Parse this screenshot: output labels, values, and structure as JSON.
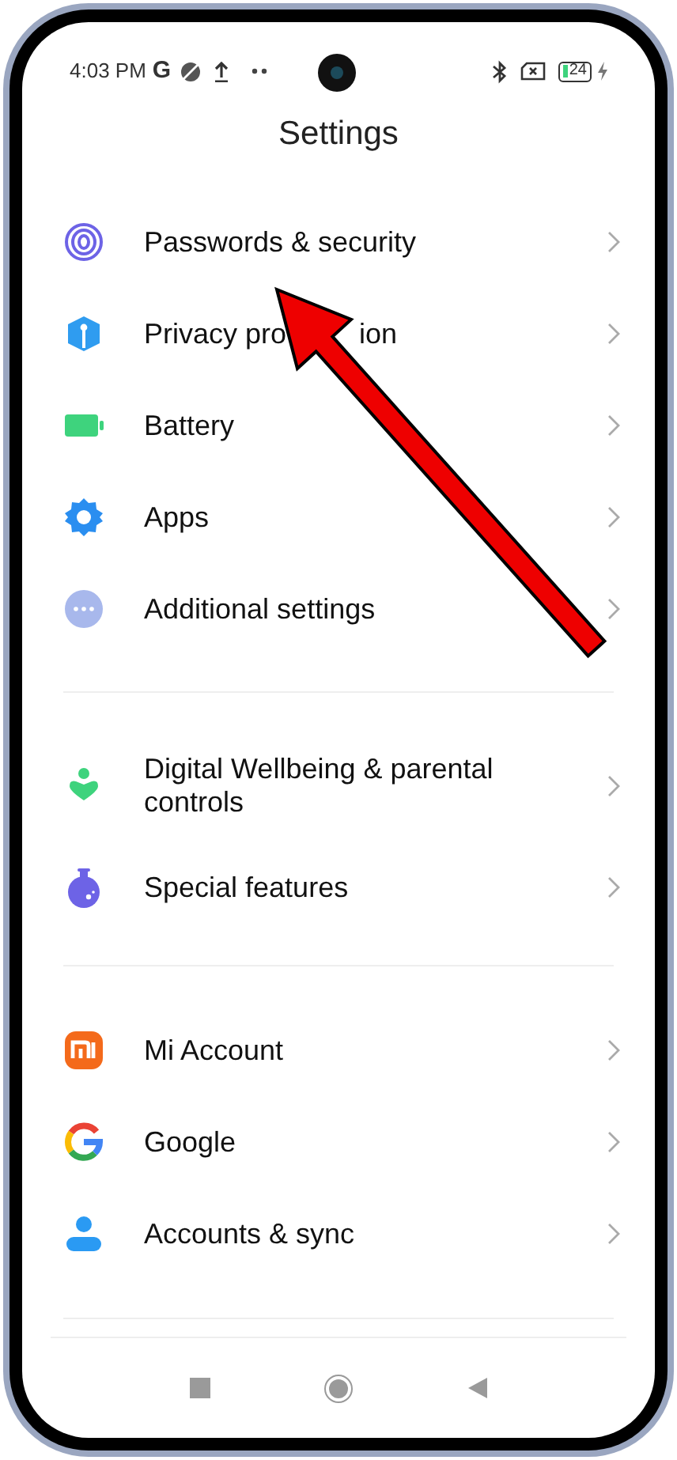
{
  "status_bar": {
    "time": "4:03 PM",
    "carrier_glyph": "G",
    "battery": "24"
  },
  "title": "Settings",
  "sections": [
    {
      "items": [
        {
          "label": "Passwords & security"
        },
        {
          "label": [
            "Privacy pro",
            "ion"
          ]
        },
        {
          "label": "Battery"
        },
        {
          "label": "Apps"
        },
        {
          "label": "Additional settings"
        }
      ]
    },
    {
      "items": [
        {
          "label": "Digital Wellbeing & parental controls"
        },
        {
          "label": "Special features"
        }
      ]
    },
    {
      "items": [
        {
          "label": "Mi Account"
        },
        {
          "label": "Google"
        },
        {
          "label": "Accounts & sync"
        }
      ]
    }
  ]
}
